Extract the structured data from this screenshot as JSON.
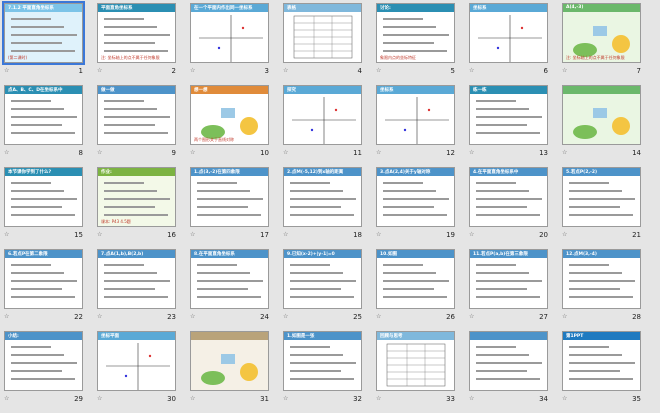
{
  "slides": [
    {
      "num": "1",
      "title": "7.1.2 平面直角坐标系",
      "sub": "(第二课时)",
      "style": "cover"
    },
    {
      "num": "2",
      "title": "平面直角坐标系",
      "sub": "注: 坐标轴上的点不属于任何象限",
      "style": "teal"
    },
    {
      "num": "3",
      "title": "在一个平面内作出同一坐标系",
      "sub": "",
      "style": "grid"
    },
    {
      "num": "4",
      "title": "表格",
      "sub": "",
      "style": "table"
    },
    {
      "num": "5",
      "title": "讨论:",
      "sub": "象限内点的坐标特征",
      "style": "teal"
    },
    {
      "num": "6",
      "title": "坐标系",
      "sub": "",
      "style": "grid"
    },
    {
      "num": "7",
      "title": "A(4,-3)",
      "sub": "注: 坐标轴上的点不属于任何象限",
      "style": "cartoon"
    },
    {
      "num": "8",
      "title": "点A、B、C、D在坐标系中",
      "sub": "",
      "style": "teal"
    },
    {
      "num": "9",
      "title": "做一做",
      "sub": "",
      "style": "white"
    },
    {
      "num": "10",
      "title": "想一想",
      "sub": "两个图形关于直线对称",
      "style": "leaf"
    },
    {
      "num": "11",
      "title": "探究",
      "sub": "",
      "style": "grid"
    },
    {
      "num": "12",
      "title": "坐标系",
      "sub": "",
      "style": "grid"
    },
    {
      "num": "13",
      "title": "练一练",
      "sub": "",
      "style": "teal"
    },
    {
      "num": "14",
      "title": "",
      "sub": "",
      "style": "cartoon"
    },
    {
      "num": "15",
      "title": "本节课你学到了什么?",
      "sub": "",
      "style": "teal"
    },
    {
      "num": "16",
      "title": "作业:",
      "sub": "课本: P43 4.5题",
      "style": "green"
    },
    {
      "num": "17",
      "title": "1.点(3,-2)在第四象限",
      "sub": "",
      "style": "white"
    },
    {
      "num": "18",
      "title": "2.点M(-5,12)到x轴的距离",
      "sub": "",
      "style": "white"
    },
    {
      "num": "19",
      "title": "3.点A(2,4)关于y轴对称",
      "sub": "",
      "style": "white"
    },
    {
      "num": "20",
      "title": "4.在平面直角坐标系中",
      "sub": "",
      "style": "white"
    },
    {
      "num": "21",
      "title": "5.若点P(2,-2)",
      "sub": "",
      "style": "white"
    },
    {
      "num": "22",
      "title": "6.若点P在第二象限",
      "sub": "",
      "style": "white"
    },
    {
      "num": "23",
      "title": "7.点A(1,b),B(2,b)",
      "sub": "",
      "style": "white"
    },
    {
      "num": "24",
      "title": "8.在平面直角坐标系",
      "sub": "",
      "style": "white"
    },
    {
      "num": "25",
      "title": "9.已知(x-2)+|y-1|=0",
      "sub": "",
      "style": "white"
    },
    {
      "num": "26",
      "title": "10.如图",
      "sub": "",
      "style": "white"
    },
    {
      "num": "27",
      "title": "11.若点P(a,b)在第三象限",
      "sub": "",
      "style": "white"
    },
    {
      "num": "28",
      "title": "12.点M(3,-4)",
      "sub": "",
      "style": "white"
    },
    {
      "num": "29",
      "title": "小结:",
      "sub": "",
      "style": "white"
    },
    {
      "num": "30",
      "title": "坐标平面",
      "sub": "",
      "style": "grid"
    },
    {
      "num": "31",
      "title": "",
      "sub": "",
      "style": "photo"
    },
    {
      "num": "32",
      "title": "1.如图是一张",
      "sub": "",
      "style": "white"
    },
    {
      "num": "33",
      "title": "回顾与思考",
      "sub": "",
      "style": "table"
    },
    {
      "num": "34",
      "title": "",
      "sub": "",
      "style": "white"
    },
    {
      "num": "35",
      "title": "第1PPT",
      "sub": "",
      "style": "brand"
    }
  ],
  "selected_slide": "1"
}
